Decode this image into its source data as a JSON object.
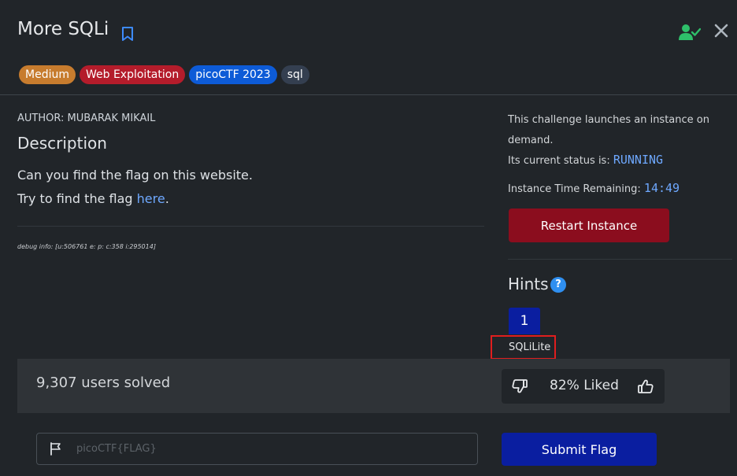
{
  "challenge": {
    "title": "More SQLi",
    "tags": [
      "Medium",
      "Web Exploitation",
      "picoCTF 2023",
      "sql"
    ],
    "author": "AUTHOR: MUBARAK MIKAIL",
    "description_heading": "Description",
    "description_line1": "Can you find the flag on this website.",
    "description_line2_prefix": "Try to find the flag ",
    "description_link": "here",
    "description_line2_suffix": ".",
    "debug_info": "debug info: [u:506761 e: p: c:358 i:295014]"
  },
  "instance": {
    "intro": "This challenge launches an instance on demand.",
    "status_label": "Its current status is: ",
    "status_value": "RUNNING",
    "time_label": "Instance Time Remaining: ",
    "time_value": "14:49",
    "restart_label": "Restart Instance"
  },
  "hints": {
    "heading": "Hints",
    "help_glyph": "?",
    "tabs": [
      "1"
    ],
    "active_content": "SQLiLite"
  },
  "stats": {
    "solved": "9,307 users solved",
    "liked": "82% Liked"
  },
  "flag_form": {
    "placeholder": "picoCTF{FLAG}",
    "submit_label": "Submit Flag"
  },
  "icons": {
    "bookmark": "bookmark-icon",
    "user_check": "user-check-icon",
    "close": "close-icon",
    "help": "question-circle-icon",
    "thumb_down": "thumbs-down-icon",
    "thumb_up": "thumbs-up-icon",
    "flag": "flag-icon"
  },
  "colors": {
    "background": "#212529",
    "tag_medium": "#c77c2e",
    "tag_web": "#b41c2b",
    "tag_event": "#0d5bd7",
    "tag_sql": "#343f50",
    "restart": "#8b0d1e",
    "primary": "#0a1ea0",
    "status_blue": "#6ea8fe",
    "user_check_green": "#2ebf6a",
    "highlight_red": "#e01e1e"
  }
}
